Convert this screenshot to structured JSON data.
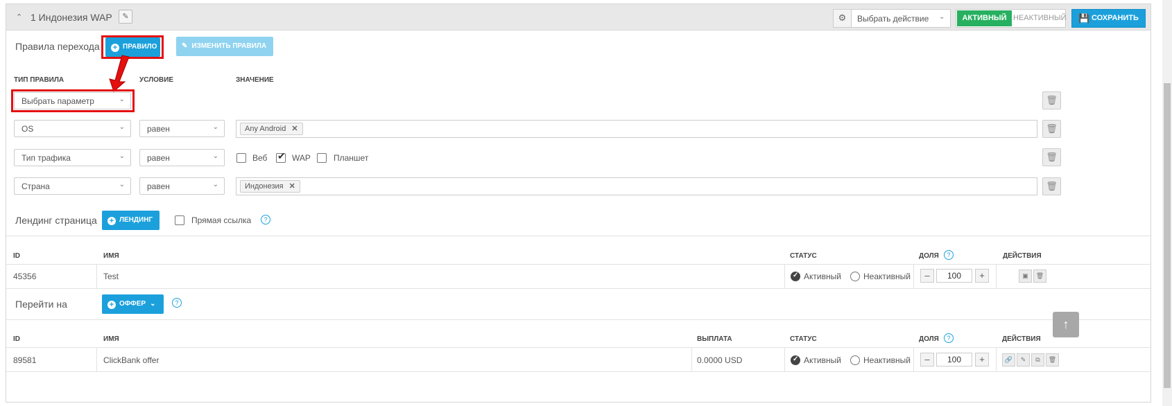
{
  "header": {
    "title": "1 Индонезия WAP",
    "action_select": "Выбрать действие",
    "status_active": "АКТИВНЫЙ",
    "status_inactive": "НЕАКТИВНЫЙ",
    "save_label": "СОХРАНИТЬ"
  },
  "rules": {
    "label": "Правила перехода",
    "add_rule_label": "ПРАВИЛО",
    "edit_rules_label": "ИЗМЕНИТЬ ПРАВИЛА",
    "col_type": "ТИП ПРАВИЛА",
    "col_condition": "УСЛОВИЕ",
    "col_value": "ЗНАЧЕНИЕ",
    "new_param_placeholder": "Выбрать параметр",
    "rows": [
      {
        "type": "OS",
        "condition": "равен",
        "tag": "Any Android"
      },
      {
        "type": "Тип трафика",
        "condition": "равен"
      },
      {
        "type": "Страна",
        "condition": "равен",
        "tag": "Индонезия"
      }
    ],
    "traffic_options": [
      {
        "label": "Веб",
        "checked": false
      },
      {
        "label": "WAP",
        "checked": true
      },
      {
        "label": "Планшет",
        "checked": false
      }
    ]
  },
  "landing": {
    "label": "Лендинг страница",
    "add_label": "ЛЕНДИНГ",
    "direct_link_label": "Прямая ссылка",
    "columns": {
      "id": "ID",
      "name": "ИМЯ",
      "status": "СТАТУС",
      "share": "ДОЛЯ",
      "actions": "ДЕЙСТВИЯ"
    },
    "row": {
      "id": "45356",
      "name": "Test",
      "active": "Активный",
      "inactive": "Неактивный",
      "share": "100"
    }
  },
  "offer": {
    "label": "Перейти на",
    "add_label": "ОФФЕР",
    "columns": {
      "id": "ID",
      "name": "ИМЯ",
      "payout": "ВЫПЛАТА",
      "status": "СТАТУС",
      "share": "ДОЛЯ",
      "actions": "ДЕЙСТВИЯ"
    },
    "row": {
      "id": "89581",
      "name": "ClickBank offer",
      "payout": "0.0000 USD",
      "active": "Активный",
      "inactive": "Неактивный",
      "share": "100"
    }
  },
  "colors": {
    "primary": "#1ba0dc",
    "success": "#27b060",
    "highlight": "#e40f0f"
  }
}
